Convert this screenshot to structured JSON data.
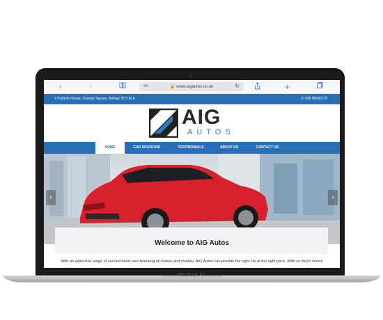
{
  "browser": {
    "back_icon": "chevron-left-icon",
    "forward_icon": "chevron-right-icon",
    "text_size_label": "AA",
    "url": "www.aigautos.co.uk",
    "lock_icon": "lock-icon",
    "reload_icon": "reload-icon"
  },
  "infobar": {
    "address": "Forsyth House, Cromac Square, Belfast, BT2 8LA",
    "phone": "028 95680170"
  },
  "logo": {
    "name": "AIG",
    "sub": "AUTOS"
  },
  "nav": {
    "items": [
      {
        "label": "HOME"
      },
      {
        "label": "CAR SOURCING"
      },
      {
        "label": "TESTIMONIALS"
      },
      {
        "label": "ABOUT US"
      },
      {
        "label": "CONTACT US"
      }
    ]
  },
  "hero": {
    "prev_icon": "chevron-left-icon",
    "next_icon": "chevron-right-icon"
  },
  "welcome": {
    "title": "Welcome to AIG Autos",
    "text": "With an extensive range of second hand cars featuring all makes and models, AIG Autos can provide the right car at the right price. With so much choice"
  },
  "device": {
    "label": "MacBook Air"
  },
  "colors": {
    "brand_blue": "#2a6fb5",
    "car_red": "#d8212c"
  }
}
